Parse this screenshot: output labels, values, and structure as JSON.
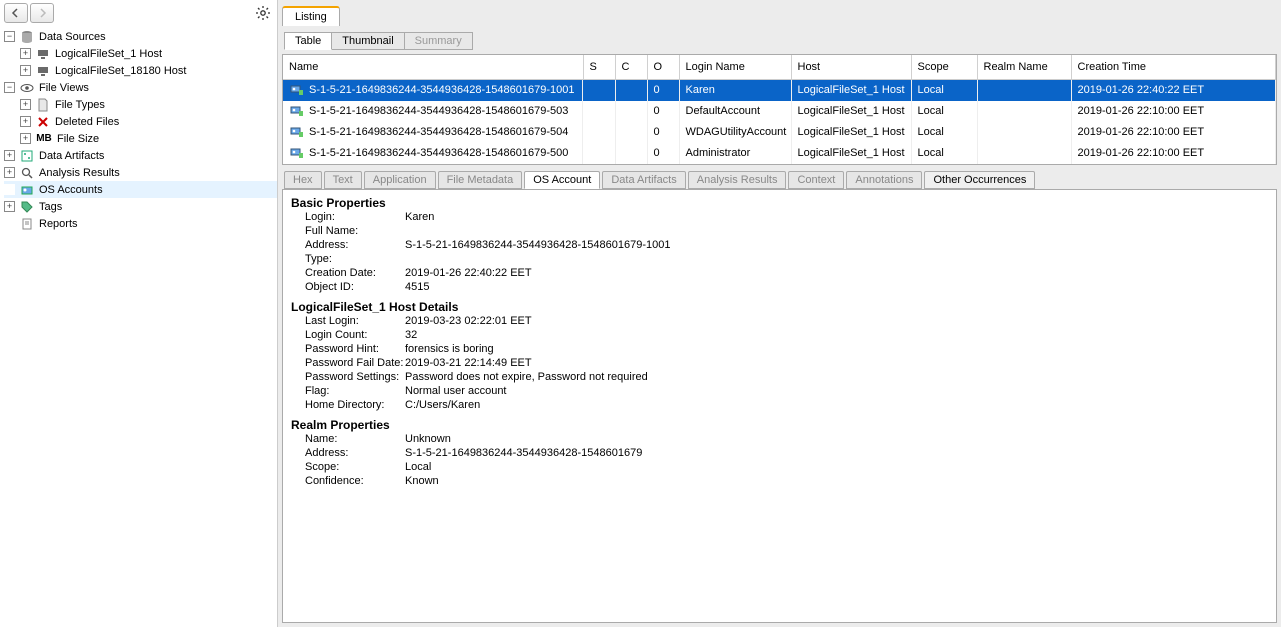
{
  "sidebar": {
    "items": [
      {
        "label": "Data Sources",
        "children": [
          {
            "label": "LogicalFileSet_1 Host"
          },
          {
            "label": "LogicalFileSet_18180 Host"
          }
        ]
      },
      {
        "label": "File Views",
        "children": [
          {
            "label": "File Types"
          },
          {
            "label": "Deleted Files"
          },
          {
            "label": "File Size",
            "prefix": "MB"
          }
        ]
      },
      {
        "label": "Data Artifacts"
      },
      {
        "label": "Analysis Results"
      },
      {
        "label": "OS Accounts",
        "selected": true
      },
      {
        "label": "Tags"
      },
      {
        "label": "Reports"
      }
    ]
  },
  "tabs": {
    "listing": "Listing"
  },
  "viewTabs": {
    "table": "Table",
    "thumbnail": "Thumbnail",
    "summary": "Summary"
  },
  "table": {
    "cols": [
      "Name",
      "S",
      "C",
      "O",
      "Login Name",
      "Host",
      "Scope",
      "Realm Name",
      "Creation Time"
    ],
    "rows": [
      {
        "name": "S-1-5-21-1649836244-3544936428-1548601679-1001",
        "s": "",
        "c": "",
        "o": "0",
        "login": "Karen",
        "host": "LogicalFileSet_1 Host",
        "scope": "Local",
        "realm": "",
        "time": "2019-01-26 22:40:22 EET",
        "selected": true
      },
      {
        "name": "S-1-5-21-1649836244-3544936428-1548601679-503",
        "s": "",
        "c": "",
        "o": "0",
        "login": "DefaultAccount",
        "host": "LogicalFileSet_1 Host",
        "scope": "Local",
        "realm": "",
        "time": "2019-01-26 22:10:00 EET"
      },
      {
        "name": "S-1-5-21-1649836244-3544936428-1548601679-504",
        "s": "",
        "c": "",
        "o": "0",
        "login": "WDAGUtilityAccount",
        "host": "LogicalFileSet_1 Host",
        "scope": "Local",
        "realm": "",
        "time": "2019-01-26 22:10:00 EET"
      },
      {
        "name": "S-1-5-21-1649836244-3544936428-1548601679-500",
        "s": "",
        "c": "",
        "o": "0",
        "login": "Administrator",
        "host": "LogicalFileSet_1 Host",
        "scope": "Local",
        "realm": "",
        "time": "2019-01-26 22:10:00 EET"
      }
    ]
  },
  "detailTabs": [
    "Hex",
    "Text",
    "Application",
    "File Metadata",
    "OS Account",
    "Data Artifacts",
    "Analysis Results",
    "Context",
    "Annotations",
    "Other Occurrences"
  ],
  "details": {
    "basic": {
      "title": "Basic Properties",
      "login_l": "Login:",
      "login_v": "Karen",
      "fullname_l": "Full Name:",
      "fullname_v": "",
      "address_l": "Address:",
      "address_v": "S-1-5-21-1649836244-3544936428-1548601679-1001",
      "type_l": "Type:",
      "type_v": "",
      "creation_l": "Creation Date:",
      "creation_v": "2019-01-26 22:40:22 EET",
      "objid_l": "Object ID:",
      "objid_v": "4515"
    },
    "host": {
      "title": "LogicalFileSet_1 Host Details",
      "lastlogin_l": "Last Login:",
      "lastlogin_v": "2019-03-23 02:22:01 EET",
      "logincount_l": "Login Count:",
      "logincount_v": "32",
      "pwhint_l": "Password Hint:",
      "pwhint_v": "forensics is boring",
      "pwfail_l": "Password Fail Date:",
      "pwfail_v": "2019-03-21 22:14:49 EET",
      "pwsettings_l": "Password Settings:",
      "pwsettings_v": "Password does not expire, Password not required",
      "flag_l": "Flag:",
      "flag_v": "Normal user account",
      "homedir_l": "Home Directory:",
      "homedir_v": "C:/Users/Karen"
    },
    "realm": {
      "title": "Realm Properties",
      "name_l": "Name:",
      "name_v": "Unknown",
      "address_l": "Address:",
      "address_v": "S-1-5-21-1649836244-3544936428-1548601679",
      "scope_l": "Scope:",
      "scope_v": "Local",
      "confidence_l": "Confidence:",
      "confidence_v": "Known"
    }
  }
}
